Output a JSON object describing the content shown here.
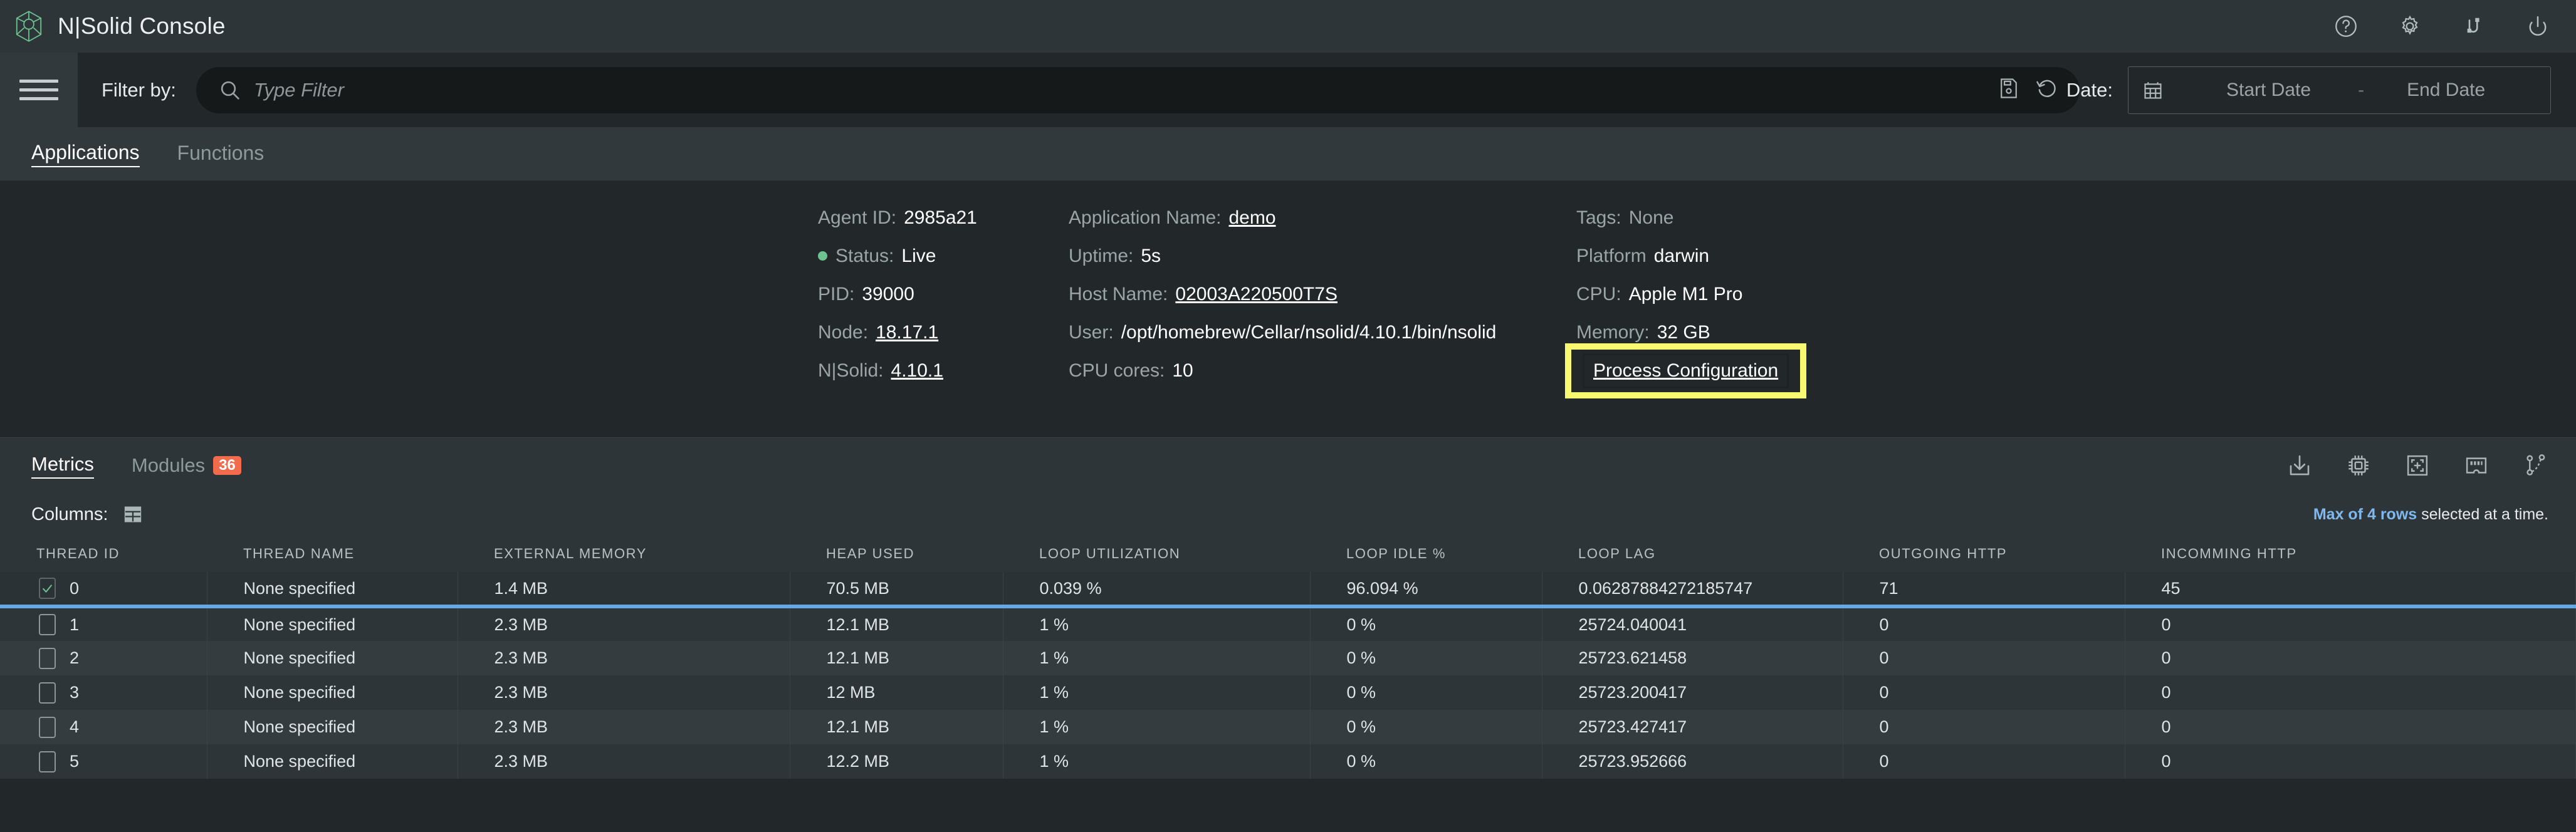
{
  "app": {
    "title": "N|Solid Console",
    "logo_icon": "nsolid-cube-icon",
    "actions": [
      {
        "name": "help-icon",
        "label": "Help"
      },
      {
        "name": "gear-icon",
        "label": "Settings"
      },
      {
        "name": "connection-icon",
        "label": "Connections"
      },
      {
        "name": "power-icon",
        "label": "Power"
      }
    ]
  },
  "filterbar": {
    "menu_icon": "hamburger-menu-icon",
    "filter_label": "Filter by:",
    "search_placeholder": "Type Filter",
    "search_value": "",
    "search_icon": "search-icon",
    "save_icon": "save-filter-icon",
    "history_icon": "filter-history-icon",
    "date_label": "Date:",
    "calendar_icon": "calendar-icon",
    "start_date_placeholder": "Start Date",
    "date_separator": "-",
    "end_date_placeholder": "End Date"
  },
  "app_tabs": [
    {
      "label": "Applications",
      "active": true
    },
    {
      "label": "Functions",
      "active": false
    }
  ],
  "process_info": {
    "column1": [
      {
        "key": "Agent ID:",
        "value": "2985a21",
        "link": false,
        "status_dot": false
      },
      {
        "key": "Status:",
        "value": "Live",
        "link": false,
        "status_dot": true
      },
      {
        "key": "PID:",
        "value": "39000",
        "link": false,
        "status_dot": false
      },
      {
        "key": "Node:",
        "value": "18.17.1",
        "link": true,
        "status_dot": false
      },
      {
        "key": "N|Solid:",
        "value": "4.10.1",
        "link": true,
        "status_dot": false
      }
    ],
    "column2": [
      {
        "key": "Application Name:",
        "value": "demo",
        "link": true
      },
      {
        "key": "Uptime:",
        "value": "5s",
        "link": false
      },
      {
        "key": "Host Name:",
        "value": "02003A220500T7S",
        "link": true
      },
      {
        "key": "User:",
        "value": "/opt/homebrew/Cellar/nsolid/4.10.1/bin/nsolid",
        "link": false
      },
      {
        "key": "CPU cores:",
        "value": "10",
        "link": false
      }
    ],
    "column3": [
      {
        "key": "Tags:",
        "value": "None",
        "muted": true
      },
      {
        "key": "Platform",
        "value": "darwin",
        "muted": false
      },
      {
        "key": "CPU:",
        "value": "Apple M1 Pro",
        "muted": false
      },
      {
        "key": "Memory:",
        "value": "32 GB",
        "muted": false
      }
    ],
    "process_configuration_link": "Process Configuration",
    "highlight_color": "#f9f871"
  },
  "metrics": {
    "tabs": [
      {
        "label": "Metrics",
        "active": true,
        "badge": null
      },
      {
        "label": "Modules",
        "active": false,
        "badge": "36"
      }
    ],
    "badge_color": "#f26b4d",
    "tools": [
      {
        "name": "download-icon",
        "label": "Download"
      },
      {
        "name": "cpu-profile-icon",
        "label": "CPU Profile"
      },
      {
        "name": "snapshot-icon",
        "label": "Heap Snapshot"
      },
      {
        "name": "heap-sampling-icon",
        "label": "Heap Sampling"
      },
      {
        "name": "trace-icon",
        "label": "Trace"
      }
    ],
    "columns_label": "Columns:",
    "columns_icon": "columns-table-icon",
    "max_rows_bold": "Max of 4 rows",
    "max_rows_rest": " selected at a time.",
    "max_rows_accent": "#7fb8ec"
  },
  "table": {
    "headers": [
      "THREAD ID",
      "THREAD NAME",
      "EXTERNAL MEMORY",
      "HEAP USED",
      "LOOP UTILIZATION",
      "LOOP IDLE %",
      "LOOP LAG",
      "OUTGOING HTTP",
      "INCOMMING HTTP"
    ],
    "rows": [
      {
        "selected": true,
        "thread_id": "0",
        "thread_name": "None specified",
        "external_memory": "1.4 MB",
        "heap_used": "70.5 MB",
        "loop_utilization": "0.039 %",
        "loop_idle": "96.094 %",
        "loop_lag": "0.06287884272185747",
        "outgoing_http": "71",
        "incomming_http": "45"
      },
      {
        "selected": false,
        "thread_id": "1",
        "thread_name": "None specified",
        "external_memory": "2.3 MB",
        "heap_used": "12.1 MB",
        "loop_utilization": "1 %",
        "loop_idle": "0 %",
        "loop_lag": "25724.040041",
        "outgoing_http": "0",
        "incomming_http": "0"
      },
      {
        "selected": false,
        "thread_id": "2",
        "thread_name": "None specified",
        "external_memory": "2.3 MB",
        "heap_used": "12.1 MB",
        "loop_utilization": "1 %",
        "loop_idle": "0 %",
        "loop_lag": "25723.621458",
        "outgoing_http": "0",
        "incomming_http": "0"
      },
      {
        "selected": false,
        "thread_id": "3",
        "thread_name": "None specified",
        "external_memory": "2.3 MB",
        "heap_used": "12 MB",
        "loop_utilization": "1 %",
        "loop_idle": "0 %",
        "loop_lag": "25723.200417",
        "outgoing_http": "0",
        "incomming_http": "0"
      },
      {
        "selected": false,
        "thread_id": "4",
        "thread_name": "None specified",
        "external_memory": "2.3 MB",
        "heap_used": "12.1 MB",
        "loop_utilization": "1 %",
        "loop_idle": "0 %",
        "loop_lag": "25723.427417",
        "outgoing_http": "0",
        "incomming_http": "0"
      },
      {
        "selected": false,
        "thread_id": "5",
        "thread_name": "None specified",
        "external_memory": "2.3 MB",
        "heap_used": "12.2 MB",
        "loop_utilization": "1 %",
        "loop_idle": "0 %",
        "loop_lag": "25723.952666",
        "outgoing_http": "0",
        "incomming_http": "0"
      }
    ]
  }
}
